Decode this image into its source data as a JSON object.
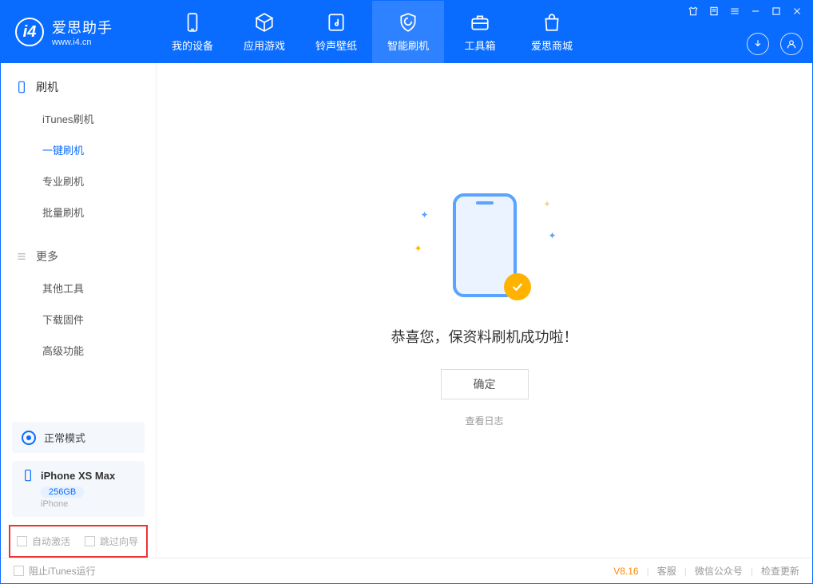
{
  "app": {
    "name_cn": "爱思助手",
    "url": "www.i4.cn"
  },
  "nav": {
    "items": [
      {
        "label": "我的设备",
        "icon": "device"
      },
      {
        "label": "应用游戏",
        "icon": "cube"
      },
      {
        "label": "铃声壁纸",
        "icon": "music"
      },
      {
        "label": "智能刷机",
        "icon": "shield",
        "active": true
      },
      {
        "label": "工具箱",
        "icon": "toolbox"
      },
      {
        "label": "爱思商城",
        "icon": "bag"
      }
    ]
  },
  "sidebar": {
    "sections": [
      {
        "title": "刷机",
        "icon": "phone",
        "items": [
          {
            "label": "iTunes刷机"
          },
          {
            "label": "一键刷机",
            "active": true
          },
          {
            "label": "专业刷机"
          },
          {
            "label": "批量刷机"
          }
        ]
      },
      {
        "title": "更多",
        "icon": "menu",
        "items": [
          {
            "label": "其他工具"
          },
          {
            "label": "下载固件"
          },
          {
            "label": "高级功能"
          }
        ]
      }
    ],
    "mode": {
      "label": "正常模式"
    },
    "device": {
      "name": "iPhone XS Max",
      "capacity": "256GB",
      "type": "iPhone"
    },
    "checkboxes": [
      {
        "label": "自动激活"
      },
      {
        "label": "跳过向导"
      }
    ]
  },
  "main": {
    "message": "恭喜您，保资料刷机成功啦！",
    "ok_label": "确定",
    "log_label": "查看日志"
  },
  "footer": {
    "block_itunes": "阻止iTunes运行",
    "version": "V8.16",
    "links": [
      "客服",
      "微信公众号",
      "检查更新"
    ]
  }
}
